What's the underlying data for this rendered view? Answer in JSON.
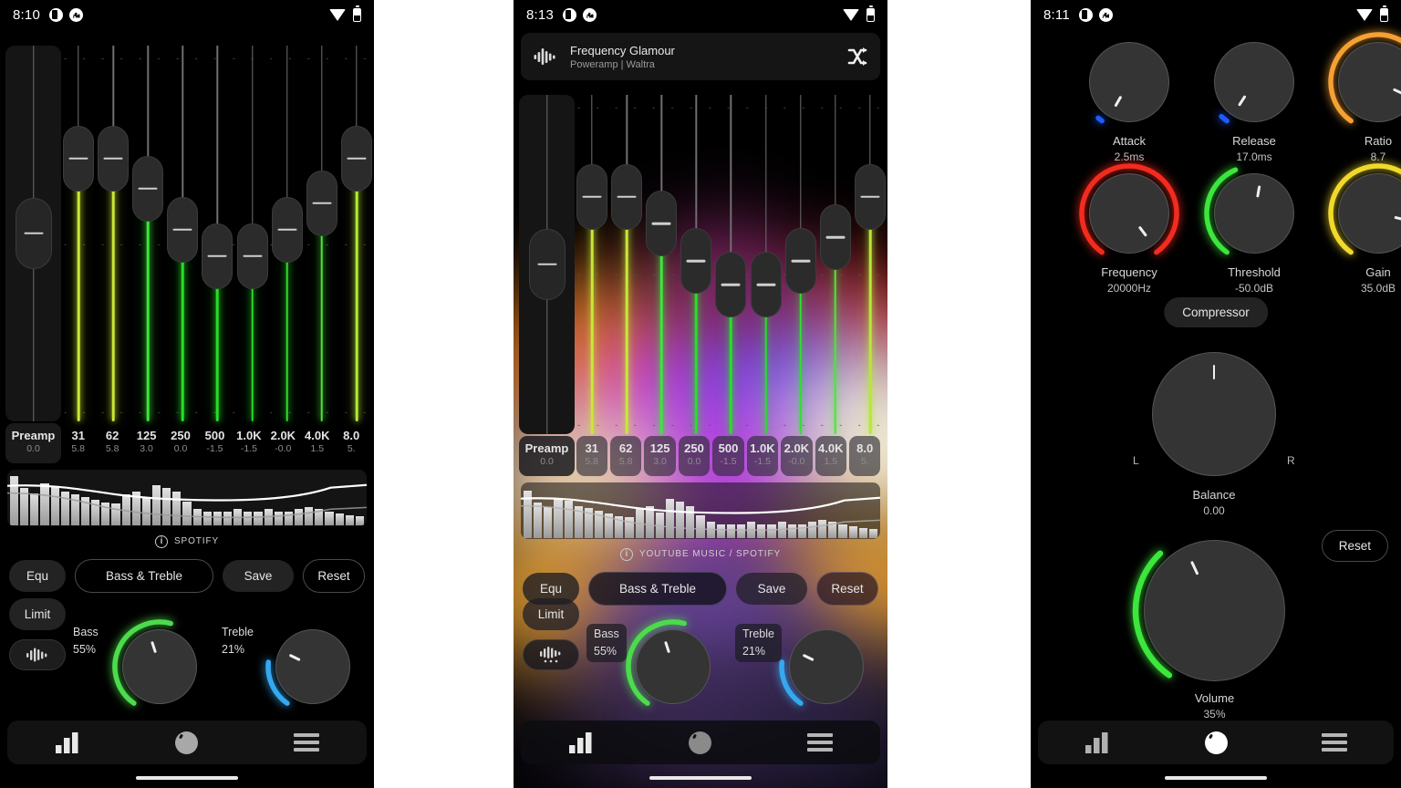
{
  "panels": [
    {
      "id": "panel-eq-dark",
      "status": {
        "time": "8:10",
        "icons": [
          "half-circle-icon",
          "chart-bars-icon",
          "wifi-icon",
          "battery-icon"
        ]
      },
      "equalizer": {
        "bands": [
          {
            "label": "Preamp",
            "value": "0.0",
            "gain": 0.0,
            "thumb_pct": 50,
            "color": "#8f8f8f"
          },
          {
            "label": "31",
            "value": "5.8",
            "gain": 5.8,
            "thumb_pct": 30,
            "color": "#c8e838"
          },
          {
            "label": "62",
            "value": "5.8",
            "gain": 5.8,
            "thumb_pct": 30,
            "color": "#c8e838"
          },
          {
            "label": "125",
            "value": "3.0",
            "gain": 3.0,
            "thumb_pct": 38,
            "color": "#3ce63c"
          },
          {
            "label": "250",
            "value": "0.0",
            "gain": 0.0,
            "thumb_pct": 49,
            "color": "#26e026"
          },
          {
            "label": "500",
            "value": "-1.5",
            "gain": -1.5,
            "thumb_pct": 56,
            "color": "#26e026"
          },
          {
            "label": "1.0K",
            "value": "-1.5",
            "gain": -1.5,
            "thumb_pct": 56,
            "color": "#26e026"
          },
          {
            "label": "2.0K",
            "value": "-0.0",
            "gain": -0.0,
            "thumb_pct": 49,
            "color": "#2ee02e"
          },
          {
            "label": "4.0K",
            "value": "1.5",
            "gain": 1.5,
            "thumb_pct": 42,
            "color": "#4ce63a"
          },
          {
            "label": "8.0",
            "value": "5.",
            "gain": 5.8,
            "thumb_pct": 30,
            "color": "#b6e838"
          }
        ]
      },
      "spectrum": {
        "bars": [
          92,
          70,
          60,
          78,
          72,
          62,
          58,
          52,
          48,
          42,
          40,
          58,
          62,
          50,
          74,
          70,
          62,
          44,
          30,
          26,
          26,
          26,
          30,
          26,
          26,
          30,
          26,
          26,
          30,
          34,
          30,
          26,
          22,
          18,
          16
        ],
        "curve_visible": true
      },
      "source": {
        "icon": "info-icon",
        "label": "SPOTIFY"
      },
      "buttons": {
        "equ": "Equ",
        "bass_treble": "Bass & Treble",
        "save": "Save",
        "reset": "Reset",
        "limit": "Limit",
        "visualizer_icon": "waveform-icon"
      },
      "knobs": [
        {
          "name": "Bass",
          "value": "55%",
          "arc_color": "#4cdb4c",
          "arc_pct": 55
        },
        {
          "name": "Treble",
          "value": "21%",
          "arc_color": "#35a8ef",
          "arc_pct": 21
        }
      ],
      "nav": {
        "items": [
          "equalizer-tab",
          "knobs-tab",
          "menu-tab"
        ],
        "active": "knobs-tab",
        "active_color": "#a8a8a8"
      }
    },
    {
      "id": "panel-eq-albumart",
      "status": {
        "time": "8:13"
      },
      "now_playing": {
        "title": "Frequency Glamour",
        "subtitle": "Poweramp | Waltra",
        "icon": "waveform-icon",
        "shuffle_icon": "shuffle-icon"
      },
      "equalizer": {
        "bands": [
          {
            "label": "Preamp",
            "value": "0.0",
            "gain": 0.0,
            "thumb_pct": 50,
            "color": "#b0b0b0"
          },
          {
            "label": "31",
            "value": "5.8",
            "gain": 5.8,
            "thumb_pct": 30,
            "color": "#c8e838"
          },
          {
            "label": "62",
            "value": "5.8",
            "gain": 5.8,
            "thumb_pct": 30,
            "color": "#c8e838"
          },
          {
            "label": "125",
            "value": "3.0",
            "gain": 3.0,
            "thumb_pct": 38,
            "color": "#3ce63c"
          },
          {
            "label": "250",
            "value": "0.0",
            "gain": 0.0,
            "thumb_pct": 49,
            "color": "#26e026"
          },
          {
            "label": "500",
            "value": "-1.5",
            "gain": -1.5,
            "thumb_pct": 56,
            "color": "#26e026"
          },
          {
            "label": "1.0K",
            "value": "-1.5",
            "gain": -1.5,
            "thumb_pct": 56,
            "color": "#26e026"
          },
          {
            "label": "2.0K",
            "value": "-0.0",
            "gain": -0.0,
            "thumb_pct": 49,
            "color": "#2ee02e"
          },
          {
            "label": "4.0K",
            "value": "1.5",
            "gain": 1.5,
            "thumb_pct": 42,
            "color": "#4ce63a"
          },
          {
            "label": "8.0",
            "value": "5.",
            "gain": 5.8,
            "thumb_pct": 30,
            "color": "#b6e838"
          }
        ]
      },
      "spectrum": {
        "bars": [
          88,
          66,
          58,
          74,
          70,
          60,
          56,
          50,
          46,
          40,
          38,
          56,
          60,
          48,
          72,
          68,
          60,
          42,
          30,
          26,
          26,
          26,
          30,
          26,
          26,
          30,
          26,
          26,
          30,
          34,
          30,
          26,
          22,
          18,
          16
        ],
        "curve_visible": true
      },
      "source": {
        "icon": "info-icon",
        "label": "YOUTUBE MUSIC / SPOTIFY"
      },
      "buttons": {
        "equ": "Equ",
        "bass_treble": "Bass & Treble",
        "save": "Save",
        "reset": "Reset",
        "limit": "Limit",
        "visualizer_icon": "waveform-icon"
      },
      "knobs": [
        {
          "name": "Bass",
          "value": "55%",
          "arc_color": "#4cdb4c",
          "arc_pct": 55
        },
        {
          "name": "Treble",
          "value": "21%",
          "arc_color": "#35a8ef",
          "arc_pct": 21
        }
      ],
      "nav": {
        "items": [
          "equalizer-tab",
          "knobs-tab",
          "menu-tab"
        ],
        "active": "knobs-tab",
        "active_color": "#8a8a8a"
      }
    },
    {
      "id": "panel-knobs",
      "status": {
        "time": "8:11"
      },
      "knobs": [
        {
          "name": "Attack",
          "value": "2.5ms",
          "arc_color": "#1e5bff",
          "arc_pct": 2,
          "indicator_deg": 210
        },
        {
          "name": "Release",
          "value": "17.0ms",
          "arc_color": "#1e5bff",
          "arc_pct": 3,
          "indicator_deg": 213
        },
        {
          "name": "Ratio",
          "value": "8.7",
          "arc_color": "#f5a033",
          "arc_pct": 86,
          "indicator_deg": 115
        },
        {
          "name": "Frequency",
          "value": "20000Hz",
          "arc_color": "#f32b1e",
          "arc_pct": 100,
          "indicator_deg": 143
        },
        {
          "name": "Threshold",
          "value": "-50.0dB",
          "arc_color": "#3ce63c",
          "arc_pct": 42,
          "indicator_deg": 10
        },
        {
          "name": "Gain",
          "value": "35.0dB",
          "arc_color": "#f0d92b",
          "arc_pct": 88,
          "indicator_deg": 103
        }
      ],
      "compressor_button": "Compressor",
      "balance": {
        "name": "Balance",
        "value": "0.00",
        "left_label": "L",
        "right_label": "R",
        "indicator_deg": 0
      },
      "volume": {
        "name": "Volume",
        "value": "35%",
        "arc_color": "#3ce63c",
        "arc_pct": 35,
        "indicator_deg": 335
      },
      "reset_button": "Reset",
      "nav": {
        "items": [
          "equalizer-tab",
          "knobs-tab",
          "menu-tab"
        ],
        "active": "knobs-tab",
        "active_color": "#ffffff"
      }
    }
  ]
}
